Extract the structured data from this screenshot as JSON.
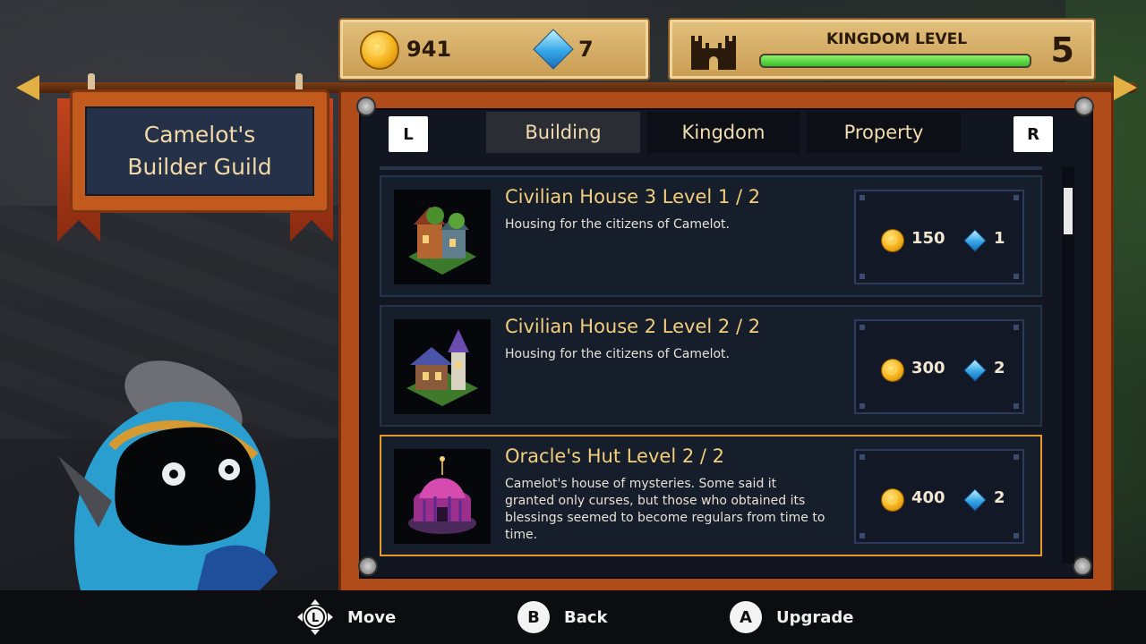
{
  "resources": {
    "gold": "941",
    "gems": "7",
    "coin_icon": "coin-icon",
    "gem_icon": "gem-icon"
  },
  "kingdom": {
    "label": "KINGDOM LEVEL",
    "level": "5",
    "progress": 1.0
  },
  "guild": {
    "title": "Camelot's Builder Guild"
  },
  "tabs": {
    "left_key": "L",
    "right_key": "R",
    "items": [
      {
        "label": "Building",
        "active": true
      },
      {
        "label": "Kingdom",
        "active": false
      },
      {
        "label": "Property",
        "active": false
      }
    ]
  },
  "buildings": [
    {
      "title": "Civilian House 3 Level 1 / 2",
      "description": "Housing for the citizens of Camelot.",
      "gold_cost": "150",
      "gem_cost": "1",
      "selected": false
    },
    {
      "title": "Civilian House 2 Level 2 / 2",
      "description": "Housing for the citizens of Camelot.",
      "gold_cost": "300",
      "gem_cost": "2",
      "selected": false
    },
    {
      "title": "Oracle's Hut Level 2 / 2",
      "description": "Camelot's house of mysteries. Some said it granted only curses, but those who obtained its blessings seemed to become regulars from time to time.",
      "gold_cost": "400",
      "gem_cost": "2",
      "selected": true
    }
  ],
  "hints": [
    {
      "button": "L",
      "label": "Move"
    },
    {
      "button": "B",
      "label": "Back"
    },
    {
      "button": "A",
      "label": "Upgrade"
    }
  ],
  "colors": {
    "accent_gold": "#f3cf7c",
    "selected_border": "#e79a2a",
    "frame": "#b04c1a",
    "progress_green": "#3cbd2e"
  }
}
